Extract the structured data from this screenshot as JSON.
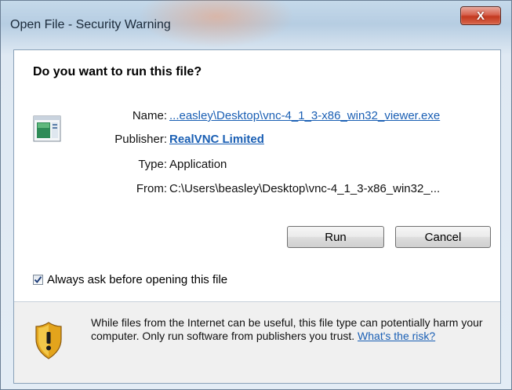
{
  "window": {
    "title": "Open File - Security Warning",
    "close_label": "X"
  },
  "dialog": {
    "question": "Do you want to run this file?",
    "fields": [
      {
        "label": "Name:",
        "value": "...easley\\Desktop\\vnc-4_1_3-x86_win32_viewer.exe"
      },
      {
        "label": "Publisher:",
        "value": "RealVNC Limited"
      },
      {
        "label": "Type:",
        "value": "Application"
      },
      {
        "label": "From:",
        "value": "C:\\Users\\beasley\\Desktop\\vnc-4_1_3-x86_win32_..."
      }
    ],
    "run_label": "Run",
    "cancel_label": "Cancel",
    "always_ask_label": "Always ask before opening this file",
    "always_ask_checked": true
  },
  "footer": {
    "warning_text": "While files from the Internet can be useful, this file type can potentially harm your computer. Only run software from publishers you trust.",
    "risk_link": "What's the risk?"
  },
  "colors": {
    "link": "#1a5fb4",
    "close_button": "#c3391f",
    "shield": "#e3a41c"
  },
  "icons": {
    "file": "application-file-icon",
    "shield": "security-shield-warning-icon",
    "close": "close-icon"
  }
}
